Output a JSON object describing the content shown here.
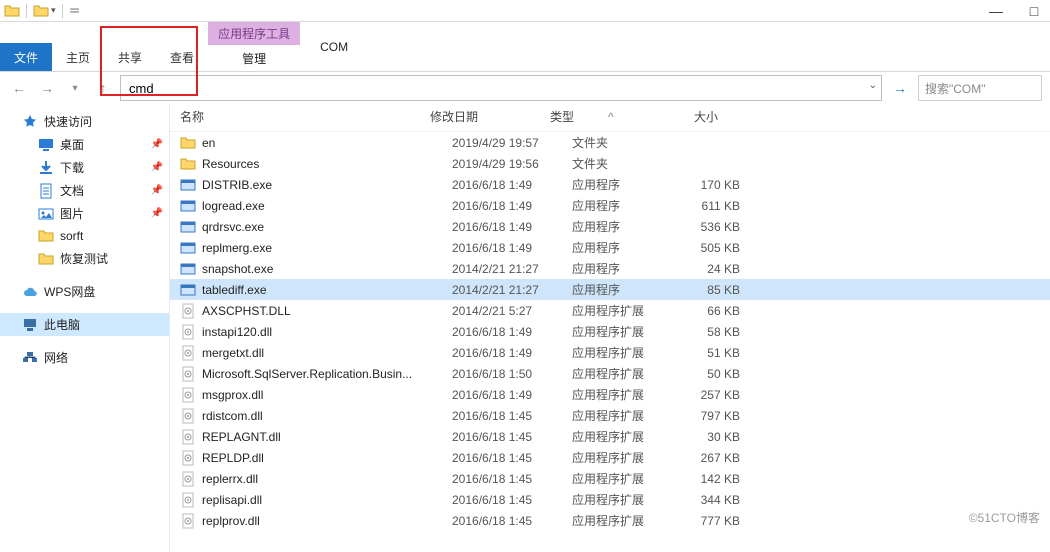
{
  "window": {
    "title": "COM",
    "tools_group_title": "应用程序工具",
    "tools_group_tab": "管理"
  },
  "tabs": {
    "file": "文件",
    "home": "主页",
    "share": "共享",
    "view": "查看"
  },
  "nav": {
    "address_value": "cmd",
    "search_placeholder": "搜索\"COM\""
  },
  "sidebar": {
    "quick": "快速访问",
    "desktop": "桌面",
    "downloads": "下载",
    "documents": "文档",
    "pictures": "图片",
    "sorft": "sorft",
    "restore": "恢复测试",
    "wps": "WPS网盘",
    "thispc": "此电脑",
    "network": "网络"
  },
  "columns": {
    "name": "名称",
    "date": "修改日期",
    "type": "类型",
    "size": "大小",
    "sort_indicator": "^"
  },
  "types": {
    "folder": "文件夹",
    "app": "应用程序",
    "ext": "应用程序扩展"
  },
  "files": [
    {
      "icon": "folder",
      "name": "en",
      "date": "2019/4/29 19:57",
      "type": "folder",
      "size": ""
    },
    {
      "icon": "folder",
      "name": "Resources",
      "date": "2019/4/29 19:56",
      "type": "folder",
      "size": ""
    },
    {
      "icon": "exe",
      "name": "DISTRIB.exe",
      "date": "2016/6/18 1:49",
      "type": "app",
      "size": "170 KB"
    },
    {
      "icon": "exe",
      "name": "logread.exe",
      "date": "2016/6/18 1:49",
      "type": "app",
      "size": "611 KB"
    },
    {
      "icon": "exe",
      "name": "qrdrsvc.exe",
      "date": "2016/6/18 1:49",
      "type": "app",
      "size": "536 KB"
    },
    {
      "icon": "exe",
      "name": "replmerg.exe",
      "date": "2016/6/18 1:49",
      "type": "app",
      "size": "505 KB"
    },
    {
      "icon": "exe",
      "name": "snapshot.exe",
      "date": "2014/2/21 21:27",
      "type": "app",
      "size": "24 KB"
    },
    {
      "icon": "exe",
      "name": "tablediff.exe",
      "date": "2014/2/21 21:27",
      "type": "app",
      "size": "85 KB",
      "selected": true
    },
    {
      "icon": "dll",
      "name": "AXSCPHST.DLL",
      "date": "2014/2/21 5:27",
      "type": "ext",
      "size": "66 KB"
    },
    {
      "icon": "dll",
      "name": "instapi120.dll",
      "date": "2016/6/18 1:49",
      "type": "ext",
      "size": "58 KB"
    },
    {
      "icon": "dll",
      "name": "mergetxt.dll",
      "date": "2016/6/18 1:49",
      "type": "ext",
      "size": "51 KB"
    },
    {
      "icon": "dll",
      "name": "Microsoft.SqlServer.Replication.Busin...",
      "date": "2016/6/18 1:50",
      "type": "ext",
      "size": "50 KB"
    },
    {
      "icon": "dll",
      "name": "msgprox.dll",
      "date": "2016/6/18 1:49",
      "type": "ext",
      "size": "257 KB"
    },
    {
      "icon": "dll",
      "name": "rdistcom.dll",
      "date": "2016/6/18 1:45",
      "type": "ext",
      "size": "797 KB"
    },
    {
      "icon": "dll",
      "name": "REPLAGNT.dll",
      "date": "2016/6/18 1:45",
      "type": "ext",
      "size": "30 KB"
    },
    {
      "icon": "dll",
      "name": "REPLDP.dll",
      "date": "2016/6/18 1:45",
      "type": "ext",
      "size": "267 KB"
    },
    {
      "icon": "dll",
      "name": "replerrx.dll",
      "date": "2016/6/18 1:45",
      "type": "ext",
      "size": "142 KB"
    },
    {
      "icon": "dll",
      "name": "replisapi.dll",
      "date": "2016/6/18 1:45",
      "type": "ext",
      "size": "344 KB"
    },
    {
      "icon": "dll",
      "name": "replprov.dll",
      "date": "2016/6/18 1:45",
      "type": "ext",
      "size": "777 KB"
    }
  ],
  "watermark": "©51CTO博客"
}
